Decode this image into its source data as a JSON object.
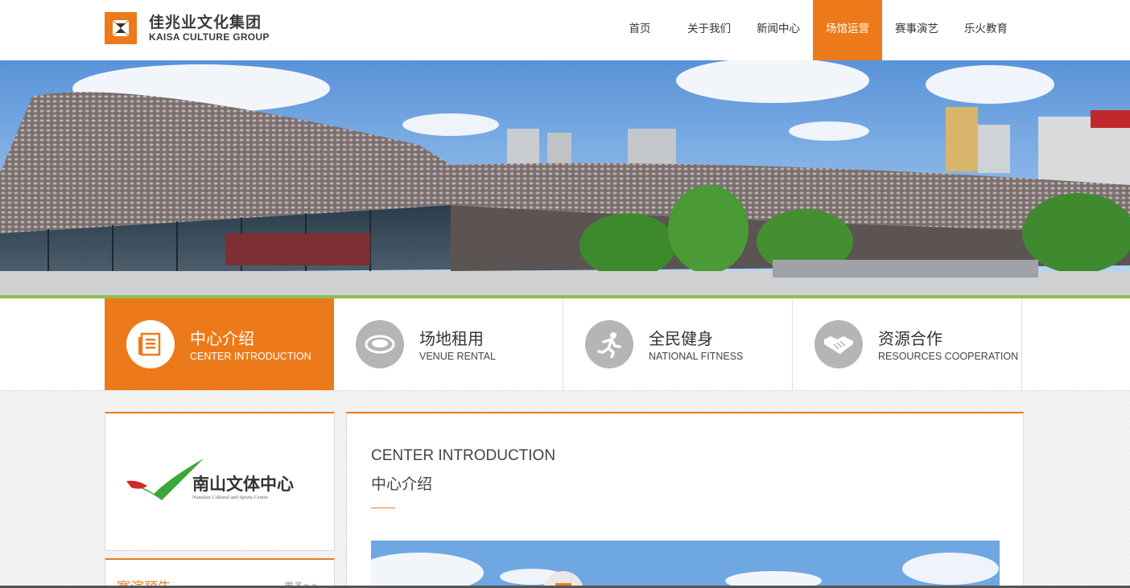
{
  "header": {
    "logo_cn": "佳兆业文化集团",
    "logo_en": "KAISA CULTURE GROUP",
    "nav": [
      {
        "label": "首页",
        "active": false
      },
      {
        "label": "关于我们",
        "active": false
      },
      {
        "label": "新闻中心",
        "active": false
      },
      {
        "label": "场馆运营",
        "active": true
      },
      {
        "label": "赛事演艺",
        "active": false
      },
      {
        "label": "乐火教育",
        "active": false
      }
    ]
  },
  "tabs": [
    {
      "cn": "中心介绍",
      "en": "CENTER INTRODUCTION",
      "icon": "document-icon",
      "active": true
    },
    {
      "cn": "场地租用",
      "en": "VENUE RENTAL",
      "icon": "stadium-icon",
      "active": false
    },
    {
      "cn": "全民健身",
      "en": "NATIONAL FITNESS",
      "icon": "runner-icon",
      "active": false
    },
    {
      "cn": "资源合作",
      "en": "RESOURCES COOPERATION",
      "icon": "handshake-icon",
      "active": false
    }
  ],
  "sidebar": {
    "venue_logo_cn": "南山文体中心",
    "venue_logo_en": "Nanshan Cultural and Sports Center",
    "box_title": "赛演预告",
    "box_more": "更多>>"
  },
  "main": {
    "title_en": "CENTER INTRODUCTION",
    "title_cn": "中心介绍"
  },
  "colors": {
    "accent": "#ed7a1a",
    "brand_green": "#3aa83a",
    "brand_red": "#d6262b"
  }
}
